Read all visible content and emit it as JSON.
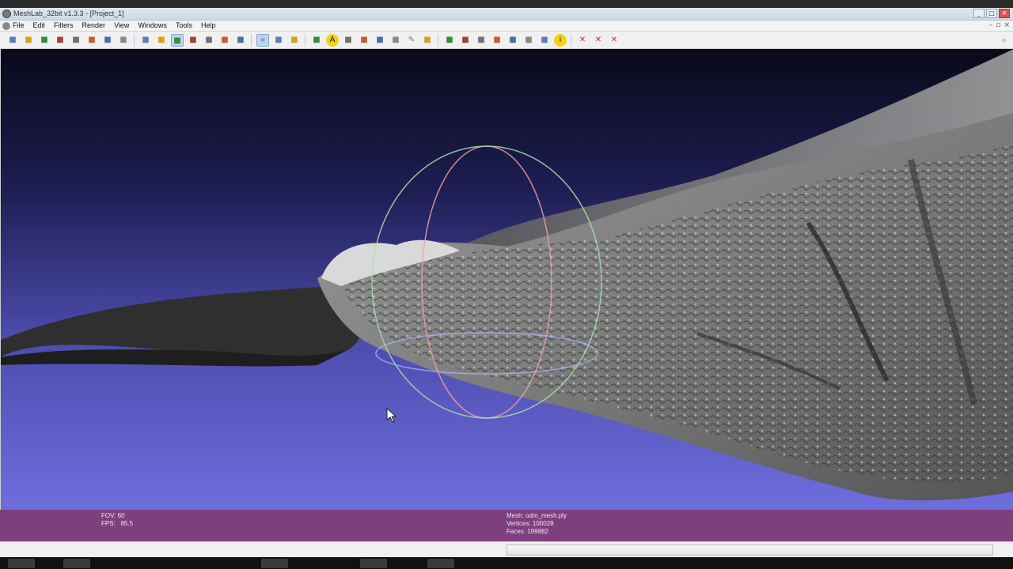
{
  "window": {
    "title": "MeshLab_32bit v1.3.3 - [Project_1]",
    "buttons": [
      "_",
      "□",
      "✕"
    ]
  },
  "menubar": {
    "items": [
      "File",
      "Edit",
      "Filters",
      "Render",
      "View",
      "Windows",
      "Tools",
      "Help"
    ],
    "mdi_buttons": [
      "–",
      "▫",
      "×"
    ]
  },
  "toolbar": {
    "icons": [
      "new-project-icon",
      "open-project-icon",
      "open-mesh-icon",
      "reload-icon",
      "save-snapshot-icon",
      "snapshot-icon",
      "layers-icon",
      "print-icon",
      "bounding-box-icon",
      "points-icon",
      "wireframe-icon",
      "hidden-lines-icon",
      "flat-lines-icon",
      "flat-icon",
      "smooth-icon",
      "light-icon",
      "fancy-lighting-icon",
      "double-side-icon",
      "manipulator-icon",
      "info-icon",
      "texture-icon",
      "quality-icon",
      "measure-icon",
      "paint-icon",
      "paint-brush-icon",
      "z-paint-icon",
      "select-faces-icon",
      "select-vertices-icon",
      "select-connected-icon",
      "select-area-icon",
      "color-select-icon",
      "align-icon",
      "pick-points-icon",
      "about-icon",
      "delete-faces-icon",
      "delete-vertices-icon",
      "delete-all-icon"
    ],
    "active_icons": [
      "wireframe-icon",
      "light-icon"
    ]
  },
  "info_panel": {
    "fov": "FOV: 60",
    "fps_label": "FPS:",
    "fps_value": "85.5",
    "mesh": "Mesh: odm_mesh.ply",
    "vertices": "Vertices: 100028",
    "faces": "Faces: 199882"
  },
  "colors": {
    "info_bar": "#7e3f7e",
    "viewport_top": "#090919",
    "viewport_bottom": "#6e6ede",
    "mesh": "#8a8a8a"
  }
}
